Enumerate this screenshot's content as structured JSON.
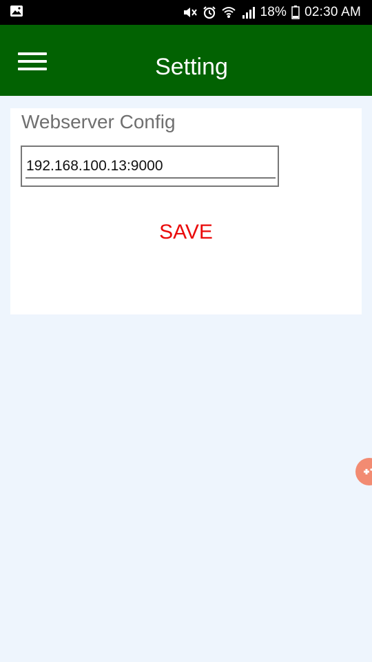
{
  "status_bar": {
    "battery_percent": "18%",
    "time": "02:30 AM",
    "icons": [
      "image-icon",
      "mute-icon",
      "alarm-icon",
      "wifi-icon",
      "signal-icon",
      "battery-icon"
    ]
  },
  "app_bar": {
    "title": "Setting",
    "menu_icon": "hamburger-menu-icon"
  },
  "card": {
    "title": "Webserver Config",
    "server_value": "192.168.100.13:9000",
    "save_label": "SAVE"
  },
  "floating": {
    "icon": "assistive-touch-icon",
    "color": "#f28b72"
  },
  "colors": {
    "app_bar": "#026202",
    "background": "#eef5fd",
    "accent": "#ea0a0a"
  }
}
